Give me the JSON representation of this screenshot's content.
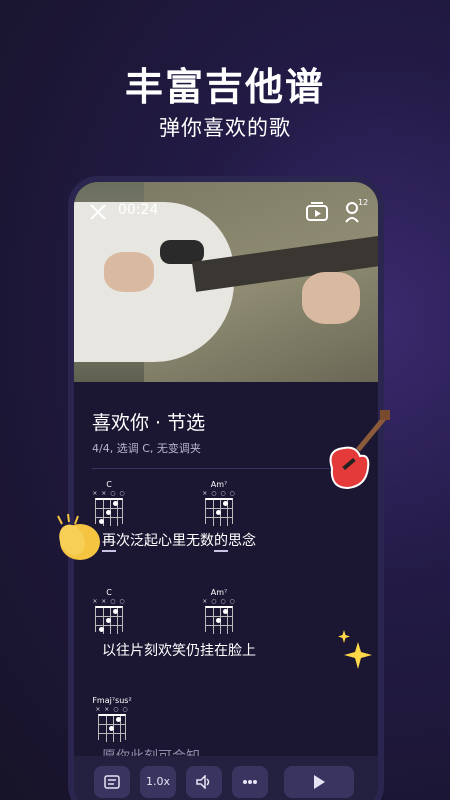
{
  "headline": "丰富吉他谱",
  "subline": "弹你喜欢的歌",
  "player": {
    "time": "00:24",
    "tuner_badge": "12"
  },
  "song": {
    "title": "喜欢你 · 节选",
    "meta": "4/4, 选调 C, 无变调夹"
  },
  "chords": [
    {
      "name": "C",
      "marks": "× × ○ ○"
    },
    {
      "name": "Am⁷",
      "marks": "× ○ ○ ○"
    },
    {
      "name": "C",
      "marks": "× × ○ ○"
    },
    {
      "name": "Am⁷",
      "marks": "× ○ ○ ○"
    },
    {
      "name": "Fmaj⁷sus²",
      "marks": "× × ○ ○"
    }
  ],
  "lyrics": [
    "再次泛起心里无数的思念",
    "以往片刻欢笑仍挂在脸上",
    "愿你此刻可会知"
  ],
  "toolbar": {
    "speed": "1.0x"
  },
  "icons": [
    "close-icon",
    "video-icon",
    "tuner-icon",
    "lyrics-icon",
    "volume-icon",
    "more-icon",
    "play-icon"
  ]
}
